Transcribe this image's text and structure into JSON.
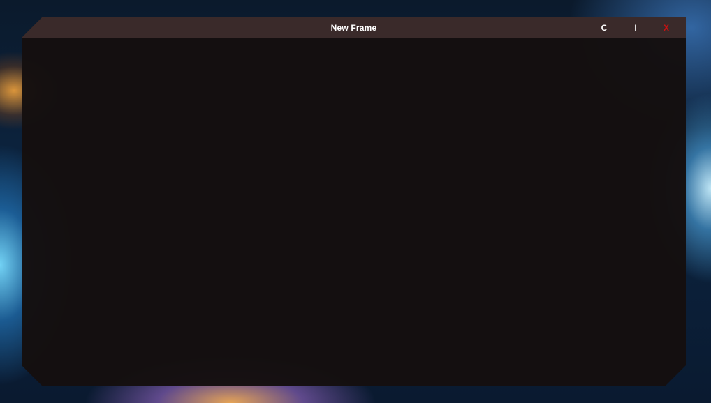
{
  "window": {
    "title": "New Frame",
    "buttons": {
      "c_label": "C",
      "i_label": "I",
      "x_label": "X"
    }
  },
  "colors": {
    "titlebar": "#3a2a2a",
    "frame_body": "#140f0f",
    "close_button": "#cc1111",
    "title_text": "#ffffff"
  }
}
